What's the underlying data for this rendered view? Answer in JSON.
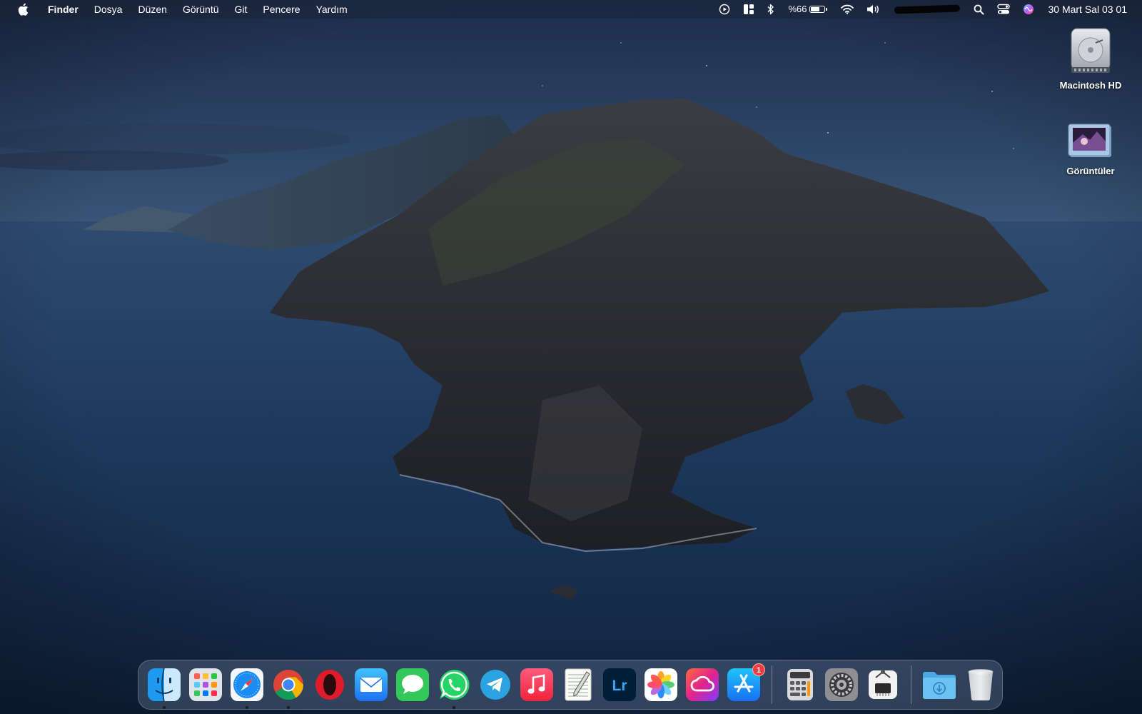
{
  "menubar": {
    "apple_icon": "apple-icon",
    "app_name": "Finder",
    "menus": [
      "Dosya",
      "Düzen",
      "Görüntü",
      "Git",
      "Pencere",
      "Yardım"
    ],
    "status": {
      "battery_percent": "%66",
      "battery_level": 0.66,
      "user_name": "",
      "clock": "30 Mart Sal  03 01",
      "icons": [
        "screen-record-icon",
        "window-layout-icon",
        "bluetooth-icon",
        "battery-icon",
        "wifi-icon",
        "volume-icon",
        "search-icon",
        "control-center-icon",
        "siri-icon"
      ]
    }
  },
  "desktop": {
    "icons": [
      {
        "name": "macintosh-hd-icon",
        "label": "Macintosh HD"
      },
      {
        "name": "screenshots-folder-icon",
        "label": "Görüntüler"
      }
    ]
  },
  "dock": {
    "apps": [
      {
        "name": "finder",
        "running": true
      },
      {
        "name": "launchpad",
        "running": false
      },
      {
        "name": "safari",
        "running": true
      },
      {
        "name": "chrome",
        "running": true
      },
      {
        "name": "opera",
        "running": false
      },
      {
        "name": "mail",
        "running": false
      },
      {
        "name": "messages",
        "running": false
      },
      {
        "name": "whatsapp",
        "running": true
      },
      {
        "name": "telegram",
        "running": false
      },
      {
        "name": "music",
        "running": false
      },
      {
        "name": "textedit",
        "running": false
      },
      {
        "name": "lightroom",
        "running": false,
        "text": "Lr"
      },
      {
        "name": "photos",
        "running": false
      },
      {
        "name": "creative-cloud",
        "running": false
      },
      {
        "name": "app-store",
        "running": false,
        "badge": "1"
      },
      {
        "name": "calculator",
        "running": false
      },
      {
        "name": "system-preferences",
        "running": false
      },
      {
        "name": "system-information",
        "running": false
      },
      {
        "name": "downloads-folder",
        "running": false
      },
      {
        "name": "trash",
        "running": false
      }
    ]
  },
  "colors": {
    "menubar_bg": "#1c2438",
    "sky_top": "#1d2e4f",
    "sea": "#1b3454",
    "badge": "#f03c3c"
  }
}
